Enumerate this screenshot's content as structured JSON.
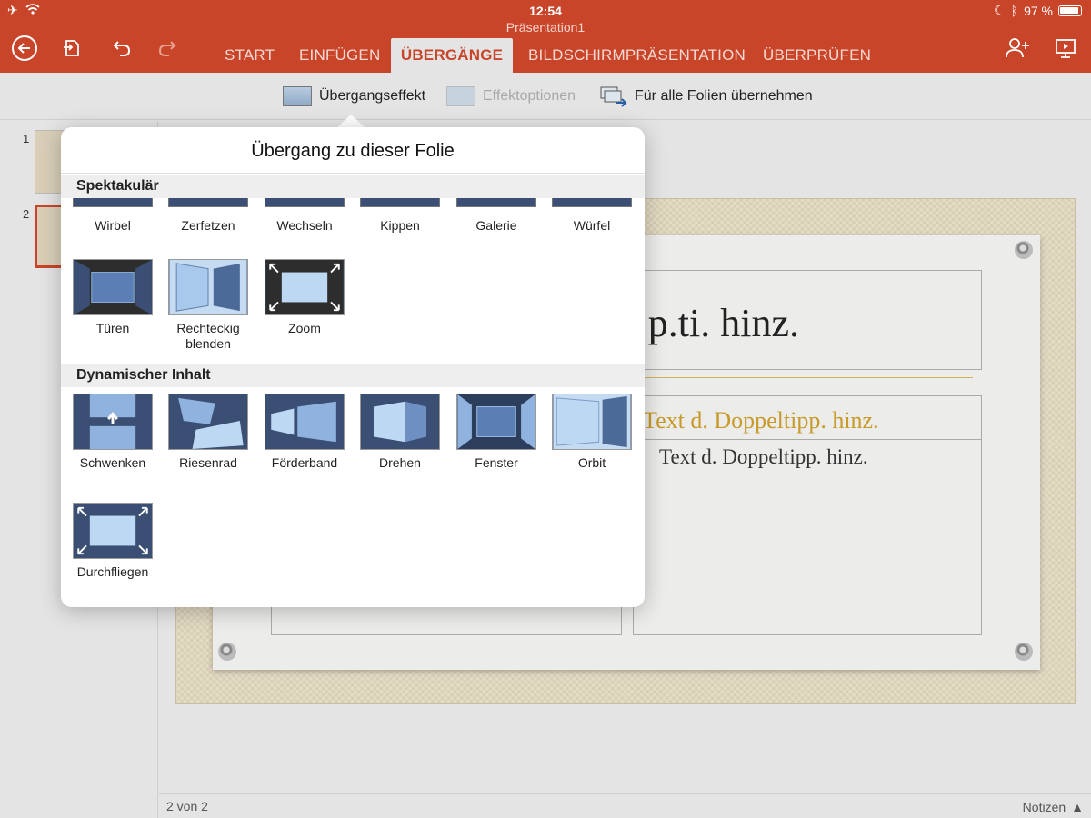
{
  "status": {
    "time": "12:54",
    "battery": "97 %"
  },
  "document": {
    "title": "Präsentation1"
  },
  "tabs": [
    "START",
    "EINFÜGEN",
    "ÜBERGÄNGE",
    "BILDSCHIRMPRÄSENTATION",
    "ÜBERPRÜFEN"
  ],
  "active_tab": "ÜBERGÄNGE",
  "ribbon": {
    "transition_effect": "Übergangseffekt",
    "effect_options": "Effektoptionen",
    "apply_all": "Für alle Folien übernehmen"
  },
  "slides": {
    "numbers": [
      "1",
      "2"
    ],
    "selected": "2"
  },
  "slide_content": {
    "title": "p.ti. hinz.",
    "right_heading": "Text d. Doppeltipp. hinz.",
    "right_bullet": "Text d. Doppeltipp. hinz."
  },
  "footer": {
    "page_indicator": "2 von 2",
    "notes": "Notizen"
  },
  "popover": {
    "title": "Übergang zu dieser Folie",
    "sections": [
      {
        "name": "Spektakulär",
        "effects": [
          "Wirbel",
          "Zerfetzen",
          "Wechseln",
          "Kippen",
          "Galerie",
          "Würfel",
          "Türen",
          "Rechteckig blenden",
          "Zoom"
        ]
      },
      {
        "name": "Dynamischer Inhalt",
        "effects": [
          "Schwenken",
          "Riesenrad",
          "Förderband",
          "Drehen",
          "Fenster",
          "Orbit",
          "Durchfliegen"
        ]
      }
    ]
  },
  "colors": {
    "accent": "#c9452a",
    "icon_dark": "#3a4f73",
    "icon_light": "#b9d3ee",
    "gold": "#c89a2a"
  }
}
